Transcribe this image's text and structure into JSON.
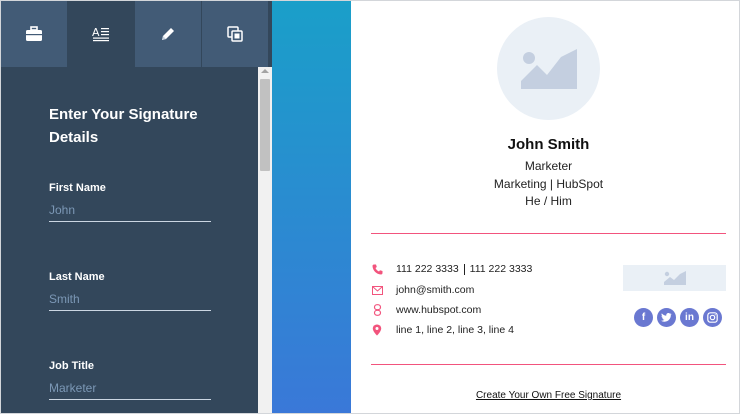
{
  "tabs": [
    {
      "icon": "briefcase-icon"
    },
    {
      "icon": "text-format-icon"
    },
    {
      "icon": "pencil-icon"
    },
    {
      "icon": "copy-icon"
    }
  ],
  "form": {
    "title": "Enter Your Signature Details",
    "fields": [
      {
        "label": "First Name",
        "placeholder": "John"
      },
      {
        "label": "Last Name",
        "placeholder": "Smith"
      },
      {
        "label": "Job Title",
        "placeholder": "Marketer"
      }
    ]
  },
  "signature": {
    "name": "John Smith",
    "title": "Marketer",
    "company_line": "Marketing | HubSpot",
    "pronouns": "He / Him",
    "phone_1": "111 222 3333",
    "phone_2": "111 222 3333",
    "email": "john@smith.com",
    "website": "www.hubspot.com",
    "address": "line 1, line 2, line 3, line 4"
  },
  "socials": [
    {
      "icon": "facebook-icon",
      "glyph": "f"
    },
    {
      "icon": "twitter-icon",
      "glyph": "t"
    },
    {
      "icon": "linkedin-icon",
      "glyph": "in"
    },
    {
      "icon": "instagram-icon",
      "glyph": "◎"
    }
  ],
  "cta": "Create Your Own Free Signature",
  "colors": {
    "sidebar": "#33475b",
    "tab": "#425b76",
    "accent_pink": "#f2547d",
    "social": "#6a78d1",
    "placeholder_bg": "#eaf0f6"
  }
}
